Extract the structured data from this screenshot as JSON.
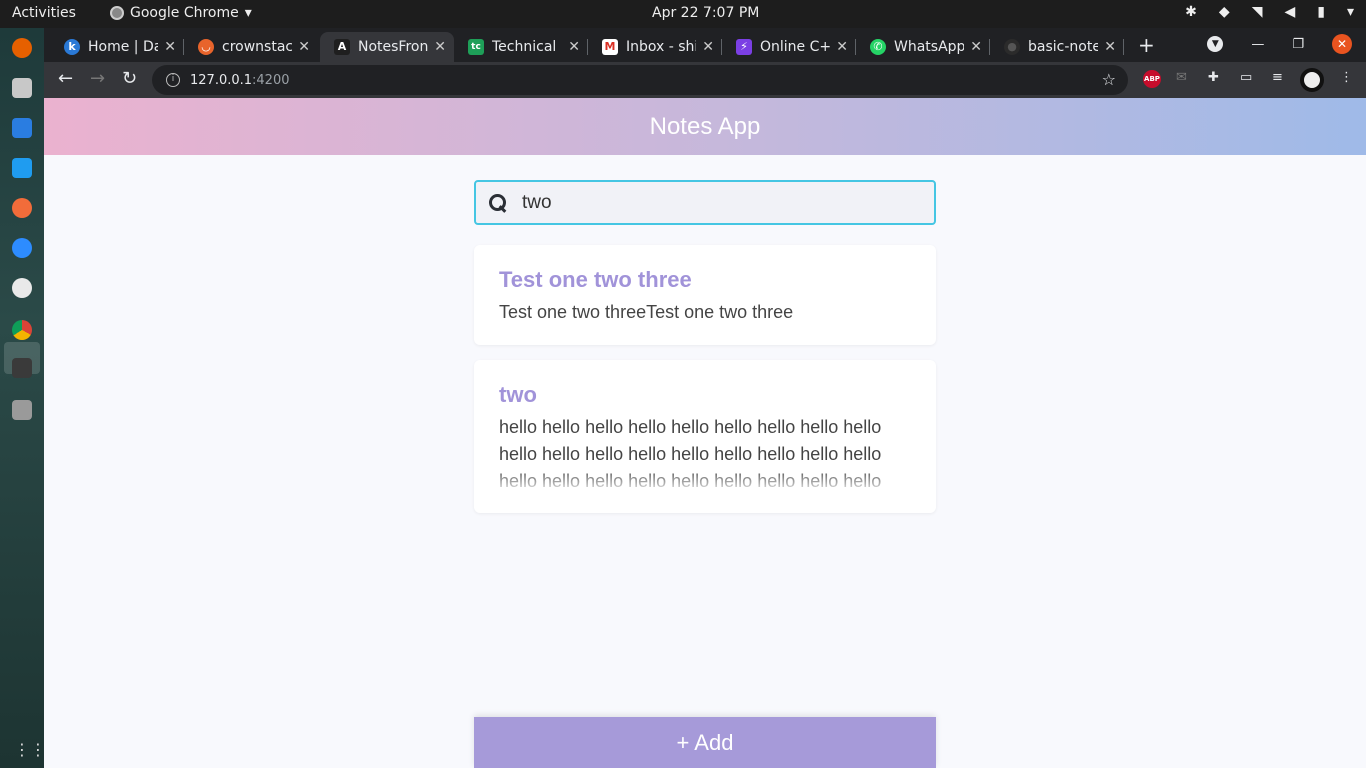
{
  "desktop": {
    "activities": "Activities",
    "app_name": "Google Chrome",
    "clock": "Apr 22  7:07 PM"
  },
  "browser": {
    "tabs": [
      {
        "title": "Home | Da",
        "fav_color": "#2a79d6",
        "fav_glyph": "k"
      },
      {
        "title": "crownstac",
        "fav_color": "#e8642b",
        "fav_glyph": "◡"
      },
      {
        "title": "NotesFron",
        "fav_color": "#1f1f1f",
        "fav_glyph": "A"
      },
      {
        "title": "Technical",
        "fav_color": "#1e9f58",
        "fav_glyph": "tc"
      },
      {
        "title": "Inbox - shi",
        "fav_color": "#d93025",
        "fav_glyph": "M"
      },
      {
        "title": "Online C+",
        "fav_color": "#7b3fe4",
        "fav_glyph": "⚡"
      },
      {
        "title": "WhatsApp",
        "fav_color": "#25d366",
        "fav_glyph": "✆"
      },
      {
        "title": "basic-note",
        "fav_color": "#2b2b2b",
        "fav_glyph": "●"
      }
    ],
    "url_host": "127.0.0.1",
    "url_port": ":4200",
    "abp_label": "ABP"
  },
  "app": {
    "title": "Notes App",
    "search_value": "two",
    "notes": [
      {
        "title": "Test one two three",
        "body": "Test one two threeTest one two three"
      },
      {
        "title": "two",
        "body": "hello hello hello hello hello hello hello hello hello hello hello hello hello hello hello hello hello hello hello hello hello hello hello hello hello hello hello"
      }
    ],
    "add_label": "+ Add"
  }
}
